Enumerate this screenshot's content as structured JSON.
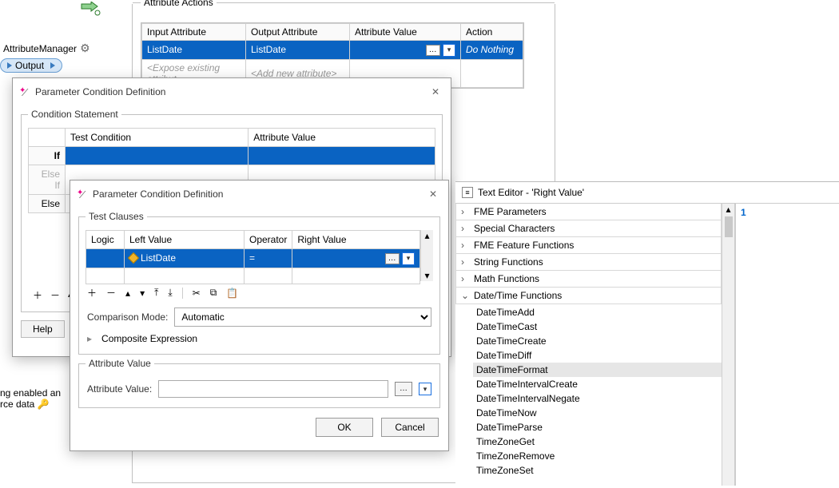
{
  "transformer": {
    "name": "AttributeManager",
    "port": "Output"
  },
  "attribute_actions": {
    "title": "Attribute Actions",
    "headers": [
      "Input Attribute",
      "Output Attribute",
      "Attribute Value",
      "Action"
    ],
    "row_selected": {
      "input": "ListDate",
      "output": "ListDate",
      "value": "",
      "action": "Do Nothing"
    },
    "row_ghost": {
      "input": "<Expose existing attribut",
      "output": "<Add new attribute>"
    }
  },
  "dlg1": {
    "title": "Parameter Condition Definition",
    "fieldset": "Condition Statement",
    "headers": [
      "",
      "Test Condition",
      "Attribute Value"
    ],
    "rows": [
      {
        "label": "If",
        "sel": true
      },
      {
        "label": "Else If",
        "dis": true
      },
      {
        "label": "Else"
      }
    ],
    "help": "Help"
  },
  "dlg2": {
    "title": "Parameter Condition Definition",
    "fieldset": "Test Clauses",
    "headers": [
      "Logic",
      "Left Value",
      "Operator",
      "Right Value"
    ],
    "row": {
      "logic": "",
      "left": "ListDate",
      "op": "=",
      "right": ""
    },
    "comparison_label": "Comparison Mode:",
    "comparison_value": "Automatic",
    "composite": "Composite Expression",
    "attr_fieldset": "Attribute Value",
    "attr_label": "Attribute Value:",
    "ok": "OK",
    "cancel": "Cancel"
  },
  "texteditor": {
    "title": "Text Editor - 'Right Value'",
    "categories": [
      {
        "name": "FME Parameters",
        "expanded": false
      },
      {
        "name": "Special Characters",
        "expanded": false
      },
      {
        "name": "FME Feature Functions",
        "expanded": false
      },
      {
        "name": "String Functions",
        "expanded": false
      },
      {
        "name": "Math Functions",
        "expanded": false
      },
      {
        "name": "Date/Time Functions",
        "expanded": true,
        "items": [
          "DateTimeAdd",
          "DateTimeCast",
          "DateTimeCreate",
          "DateTimeDiff",
          "DateTimeFormat",
          "DateTimeIntervalCreate",
          "DateTimeIntervalNegate",
          "DateTimeNow",
          "DateTimeParse",
          "TimeZoneGet",
          "TimeZoneRemove",
          "TimeZoneSet"
        ],
        "selected": "DateTimeFormat"
      }
    ],
    "line": "1"
  },
  "bg": {
    "l1": "ng enabled an",
    "l2a": "rce data ",
    "key": "🔑"
  }
}
